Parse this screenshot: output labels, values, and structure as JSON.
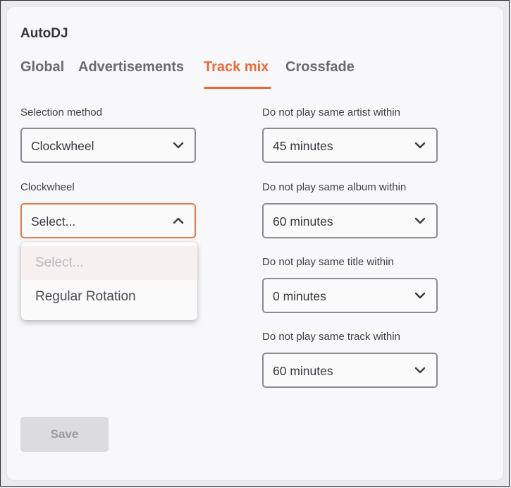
{
  "panel": {
    "title": "AutoDJ"
  },
  "tabs": [
    {
      "label": "Global"
    },
    {
      "label": "Advertisements"
    },
    {
      "label": "Track mix"
    },
    {
      "label": "Crossfade"
    }
  ],
  "active_tab": "Track mix",
  "accent_color": "#e96a35",
  "left": {
    "selection_method": {
      "label": "Selection method",
      "value": "Clockwheel"
    },
    "clockwheel": {
      "label": "Clockwheel",
      "value": "Select...",
      "options": [
        "Select...",
        "Regular Rotation"
      ]
    }
  },
  "right": {
    "artist": {
      "label": "Do not play same artist within",
      "value": "45 minutes"
    },
    "album": {
      "label": "Do not play same album within",
      "value": "60 minutes"
    },
    "title": {
      "label": "Do not play same title within",
      "value": "0 minutes"
    },
    "track": {
      "label": "Do not play same track within",
      "value": "60 minutes"
    }
  },
  "save_button": {
    "label": "Save"
  },
  "icons": {
    "select_closed": "chevron-down-icon",
    "select_open": "chevron-up-icon"
  }
}
